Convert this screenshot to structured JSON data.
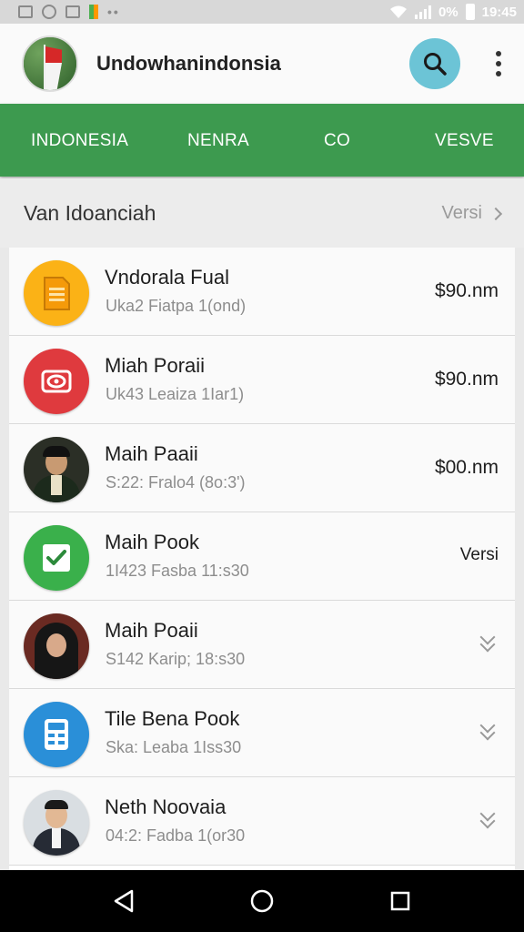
{
  "status_bar": {
    "battery_percent": "0%",
    "time": "19:45"
  },
  "app_bar": {
    "title": "Undowhanindonsia",
    "search_icon": "search-icon",
    "menu_icon": "more-vert-icon"
  },
  "tabs": [
    {
      "label": "INDONESIA"
    },
    {
      "label": "NENRA"
    },
    {
      "label": "CO"
    },
    {
      "label": "VESVE"
    }
  ],
  "section": {
    "title": "Van Idoanciah",
    "link": "Versi"
  },
  "list": [
    {
      "title": "Vndorala Fual",
      "subtitle": "Uka2 Fiatpa 1(ond)",
      "right": "$90.nm",
      "icon": "document-icon",
      "color": "#fbb216"
    },
    {
      "title": "Miah Poraii",
      "subtitle": "Uk43 Leaiza 1Iar1)",
      "right": "$90.nm",
      "icon": "eye-icon",
      "color": "#df3a3e"
    },
    {
      "title": "Maih Paaii",
      "subtitle": "S:22: Fralo4 (8o:3')",
      "right": "$00.nm",
      "icon": "avatar-man-cap",
      "color": "#2b2f26"
    },
    {
      "title": "Maih Pook",
      "subtitle": "1I423 Fasba 11:s30",
      "right": "Versi",
      "icon": "check-icon",
      "color": "#3ab04b"
    },
    {
      "title": "Maih Poaii",
      "subtitle": "S142 Karip; 18:s30",
      "right": "",
      "icon": "avatar-woman-hijab",
      "color": "#6a2a22"
    },
    {
      "title": "Tile Bena Pook",
      "subtitle": "Ska: Leaba 1Iss30",
      "right": "",
      "icon": "calculator-icon",
      "color": "#2a8fd8"
    },
    {
      "title": "Neth Noovaia",
      "subtitle": "04:2: Fadba 1(or30",
      "right": "",
      "icon": "avatar-man-suit",
      "color": "#d9dee2"
    }
  ],
  "nav_bar": {
    "back_icon": "back-triangle-icon",
    "home_icon": "home-circle-icon",
    "recents_icon": "recents-square-icon"
  }
}
